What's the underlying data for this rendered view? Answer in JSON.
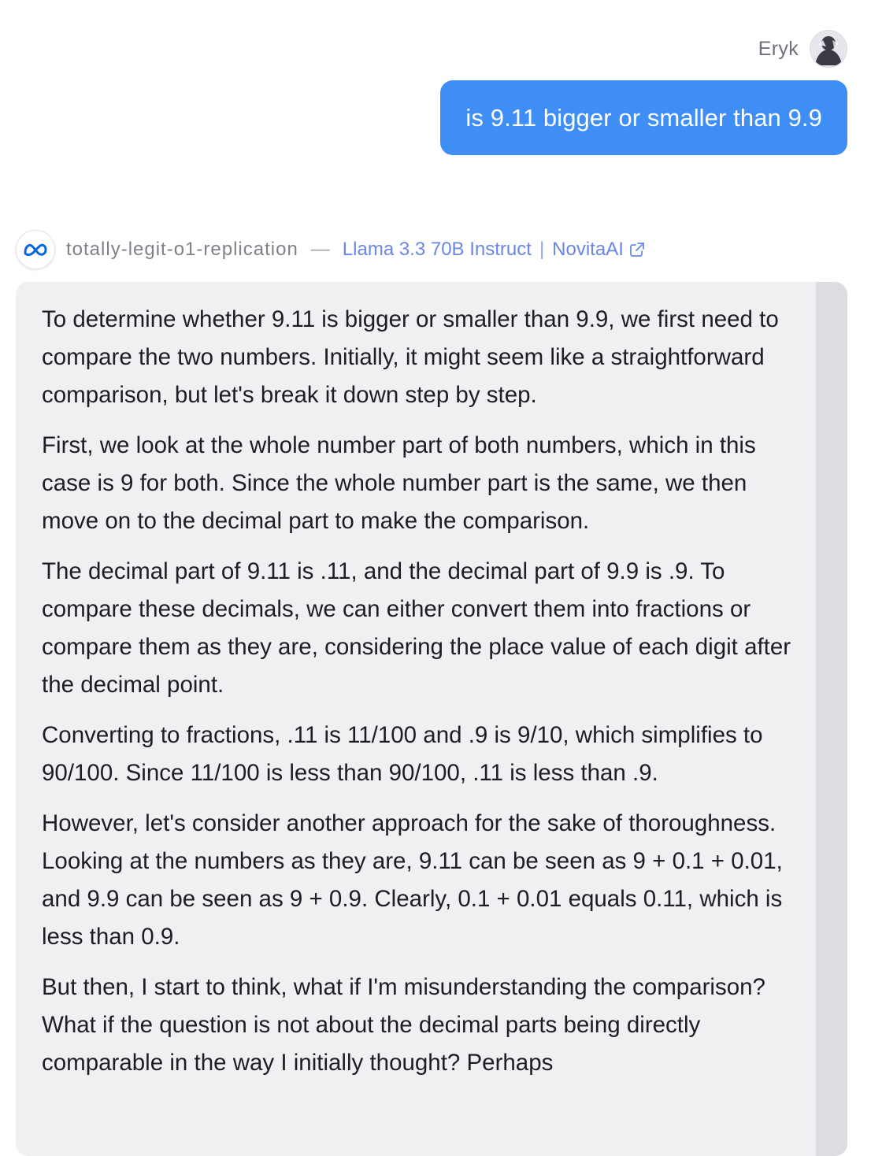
{
  "user": {
    "name": "Eryk",
    "message": "is 9.11 bigger or smaller than 9.9"
  },
  "assistant": {
    "name": "totally-legit-o1-replication",
    "separator": "—",
    "model": "Llama 3.3 70B Instruct",
    "provider": "NovitaAI",
    "paragraphs": [
      "To determine whether 9.11 is bigger or smaller than 9.9, we first need to compare the two numbers. Initially, it might seem like a straightforward comparison, but let's break it down step by step.",
      "First, we look at the whole number part of both numbers, which in this case is 9 for both. Since the whole number part is the same, we then move on to the decimal part to make the comparison.",
      "The decimal part of 9.11 is .11, and the decimal part of 9.9 is .9. To compare these decimals, we can either convert them into fractions or compare them as they are, considering the place value of each digit after the decimal point.",
      "Converting to fractions, .11 is 11/100 and .9 is 9/10, which simplifies to 90/100. Since 11/100 is less than 90/100, .11 is less than .9.",
      "However, let's consider another approach for the sake of thoroughness. Looking at the numbers as they are, 9.11 can be seen as 9 + 0.1 + 0.01, and 9.9 can be seen as 9 + 0.9. Clearly, 0.1 + 0.01 equals 0.11, which is less than 0.9.",
      "But then, I start to think, what if I'm misunderstanding the comparison? What if the question is not about the decimal parts being directly comparable in the way I initially thought? Perhaps"
    ]
  },
  "icons": {
    "bot_avatar": "meta-logo-icon",
    "external_link": "external-link-icon"
  },
  "colors": {
    "user_bubble": "#3f8ef5",
    "assistant_bubble": "#f0f0f3",
    "model_link": "#6b86e6",
    "meta_logo": "#0668e1"
  }
}
